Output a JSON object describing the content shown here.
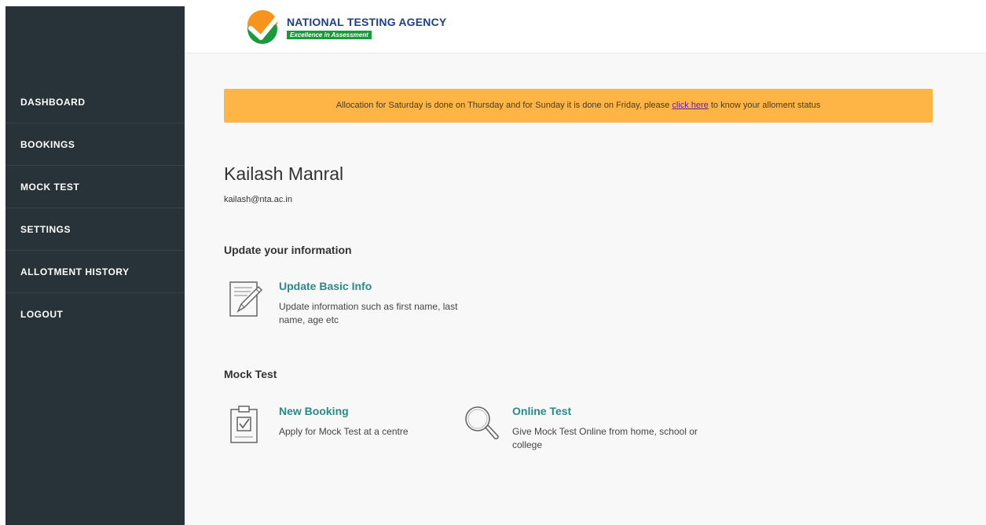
{
  "brand": {
    "name": "NATIONAL TESTING AGENCY",
    "tagline": "Excellence in Assessment",
    "colors": {
      "navy": "#1d3f8e",
      "green": "#199a3d",
      "orange": "#f7941d"
    }
  },
  "sidebar": {
    "items": [
      {
        "label": "DASHBOARD"
      },
      {
        "label": "BOOKINGS"
      },
      {
        "label": "MOCK TEST"
      },
      {
        "label": "SETTINGS"
      },
      {
        "label": "ALLOTMENT HISTORY"
      },
      {
        "label": "LOGOUT"
      }
    ]
  },
  "alert": {
    "text_before": "Allocation for Saturday is done on Thursday and for Sunday it is done on Friday, please ",
    "link_text": "click here",
    "text_after": " to know your alloment status"
  },
  "user": {
    "name": "Kailash Manral",
    "email": "kailash@nta.ac.in"
  },
  "sections": {
    "update_info": {
      "title": "Update your information",
      "cards": [
        {
          "title": "Update Basic Info",
          "description": "Update information such as first name, last name, age etc",
          "icon": "edit-document-icon"
        }
      ]
    },
    "mock_test": {
      "title": "Mock Test",
      "cards": [
        {
          "title": "New Booking",
          "description": "Apply for Mock Test at a centre",
          "icon": "clipboard-check-icon"
        },
        {
          "title": "Online Test",
          "description": "Give Mock Test Online from home, school or college",
          "icon": "magnifier-icon"
        }
      ]
    }
  },
  "colors": {
    "sidebar_bg": "#283339",
    "alert_bg": "#ffb546",
    "link_teal": "#2a8a8a",
    "content_bg": "#f8f8f8"
  }
}
